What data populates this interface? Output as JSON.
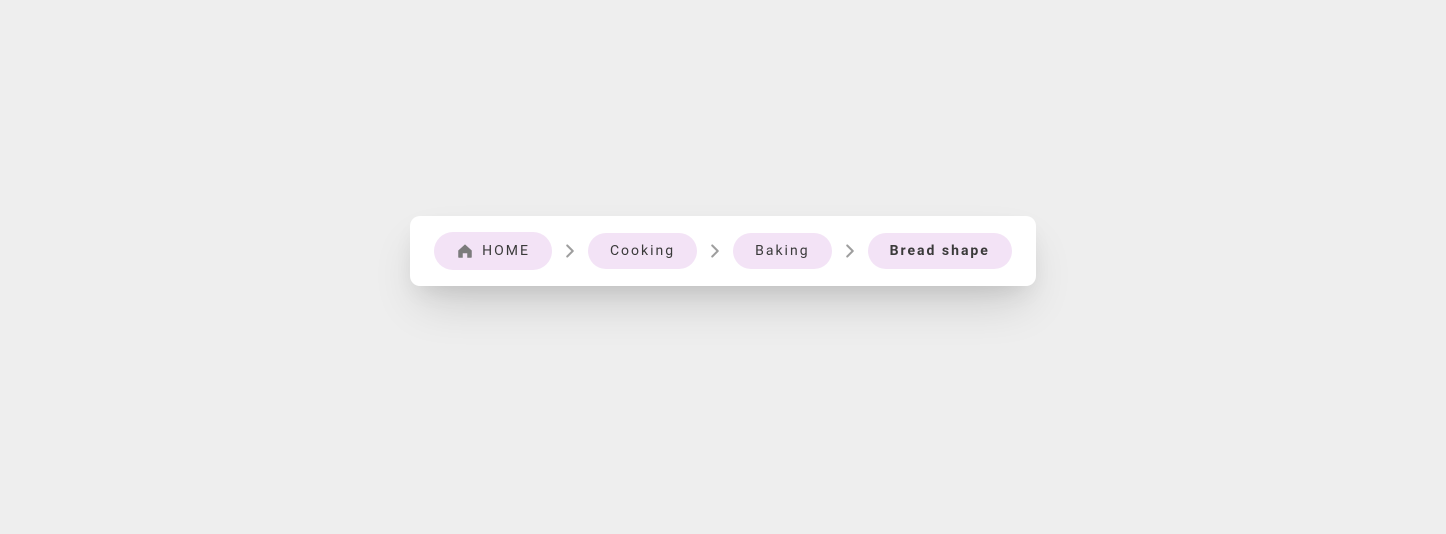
{
  "breadcrumb": {
    "items": [
      {
        "label": "HOME",
        "icon": "home",
        "current": false
      },
      {
        "label": "Cooking",
        "current": false
      },
      {
        "label": "Baking",
        "current": false
      },
      {
        "label": "Bread shape",
        "current": true
      }
    ]
  }
}
